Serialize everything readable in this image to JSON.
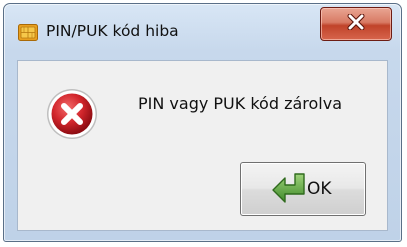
{
  "window": {
    "title": "PIN/PUK kód hiba",
    "app_icon": "sim-card-icon",
    "close_icon": "close-icon"
  },
  "dialog": {
    "icon": "error-icon",
    "message": "PIN vagy PUK kód zárolva",
    "ok_icon": "green-arrow-icon",
    "ok_label": "OK"
  },
  "colors": {
    "close_button": "#c7432a",
    "error_red": "#d2262c",
    "content_bg": "#f0f0f0"
  }
}
